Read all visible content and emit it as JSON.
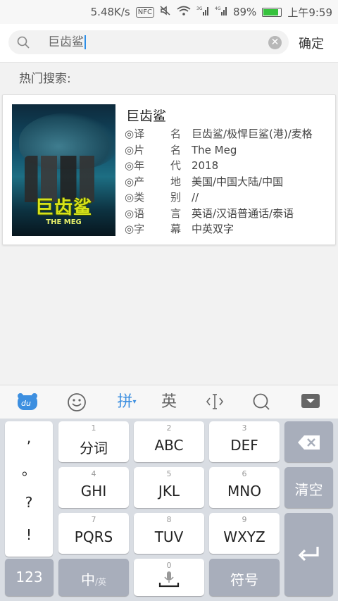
{
  "status_bar": {
    "speed": "5.48K/s",
    "nfc": "NFC",
    "net_3g": "3G",
    "net_4g": "4G",
    "battery": "89%",
    "battery_level": 0.89,
    "time": "上午9:59"
  },
  "search": {
    "query": "巨齿鲨",
    "confirm_label": "确定"
  },
  "hot_search_label": "热门搜索:",
  "result": {
    "title": "巨齿鲨",
    "poster": {
      "logo_cn": "巨齿鲨",
      "logo_en": "THE MEG"
    },
    "rows": [
      {
        "key1": "◎译",
        "key2": "名",
        "value": "巨齿鲨/极悍巨鲨(港)/麦格"
      },
      {
        "key1": "◎片",
        "key2": "名",
        "value": "The Meg"
      },
      {
        "key1": "◎年",
        "key2": "代",
        "value": "2018"
      },
      {
        "key1": "◎产",
        "key2": "地",
        "value": "美国/中国大陆/中国"
      },
      {
        "key1": "◎类",
        "key2": "别",
        "value": "//"
      },
      {
        "key1": "◎语",
        "key2": "言",
        "value": "英语/汉语普通话/泰语"
      },
      {
        "key1": "◎字",
        "key2": "幕",
        "value": "中英双字"
      }
    ]
  },
  "keyboard_toolbar": {
    "pinyin": "拼",
    "english": "英"
  },
  "keyboard": {
    "punctuation": [
      ",",
      "。",
      "?",
      "!"
    ],
    "keys": [
      {
        "num": "1",
        "label": "分词"
      },
      {
        "num": "2",
        "label": "ABC"
      },
      {
        "num": "3",
        "label": "DEF"
      },
      {
        "num": "4",
        "label": "GHI"
      },
      {
        "num": "5",
        "label": "JKL"
      },
      {
        "num": "6",
        "label": "MNO"
      },
      {
        "num": "7",
        "label": "PQRS"
      },
      {
        "num": "8",
        "label": "TUV"
      },
      {
        "num": "9",
        "label": "WXYZ"
      }
    ],
    "clear_label": "清空",
    "num_label": "123",
    "lang_main": "中",
    "lang_sub": "/英",
    "space_num": "0",
    "symbol_label": "符号"
  }
}
